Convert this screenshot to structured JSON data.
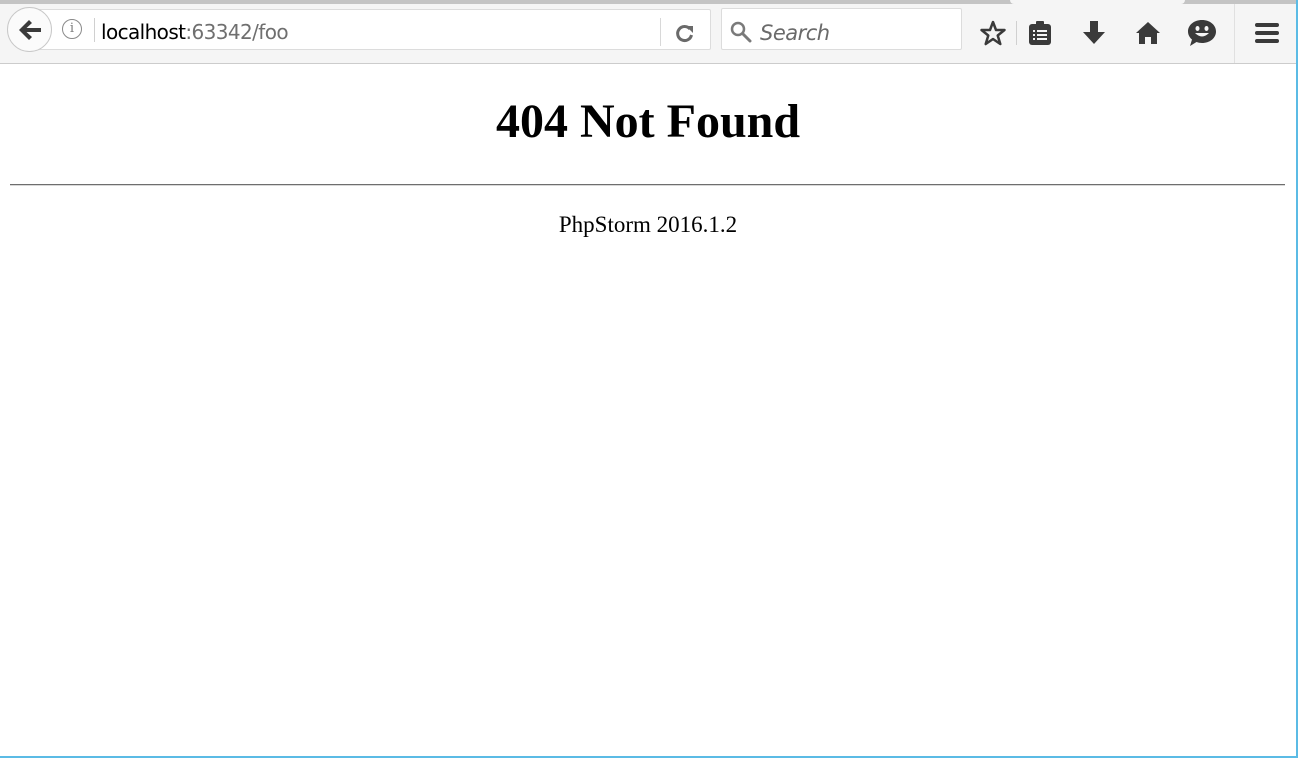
{
  "browser": {
    "url_host": "localhost",
    "url_rest": ":63342/foo",
    "search_placeholder": "Search",
    "icons": {
      "back": "back-arrow-icon",
      "info": "info-icon",
      "reload": "reload-icon",
      "search": "search-icon",
      "bookmark": "star-icon",
      "reading_list": "clipboard-list-icon",
      "downloads": "download-arrow-icon",
      "home": "home-icon",
      "hello": "chat-smiley-icon",
      "menu": "hamburger-menu-icon"
    },
    "info_glyph": "i",
    "accent_color": "#5bbbe5"
  },
  "page": {
    "heading": "404 Not Found",
    "footer": "PhpStorm 2016.1.2"
  }
}
